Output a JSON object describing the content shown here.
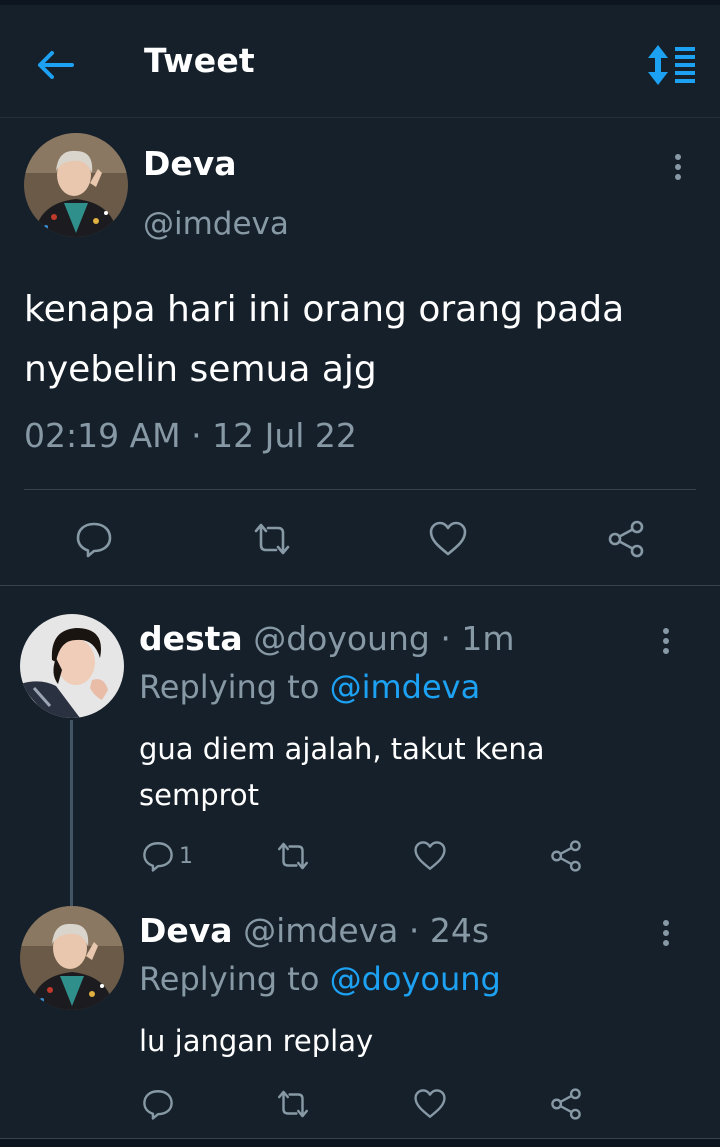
{
  "header": {
    "title": "Tweet",
    "back_icon": "arrow-left-icon",
    "sort_icon": "sort-icon",
    "accent": "#1da1f2"
  },
  "main_tweet": {
    "name": "Deva",
    "handle": "@imdeva",
    "text": "kenapa hari ini orang orang pada\nnyebelin semua ajg",
    "time": "02:19 AM",
    "date": "12 Jul 22",
    "actions": [
      "reply-icon",
      "retweet-icon",
      "like-icon",
      "share-icon"
    ]
  },
  "replies": [
    {
      "name": "desta",
      "handle": "@doyoung",
      "age": "1m",
      "replying_label": "Replying to",
      "replying_to": "@imdeva",
      "text": "gua diem ajalah, takut kena\nsemprot",
      "reply_count": "1"
    },
    {
      "name": "Deva",
      "handle": "@imdeva",
      "age": "24s",
      "replying_label": "Replying to",
      "replying_to": "@doyoung",
      "text": "lu jangan replay",
      "reply_count": ""
    }
  ],
  "colors": {
    "background": "#15202b",
    "text": "#ffffff",
    "secondary": "#8899a6",
    "link": "#1da1f2",
    "divider": "#38444d"
  }
}
